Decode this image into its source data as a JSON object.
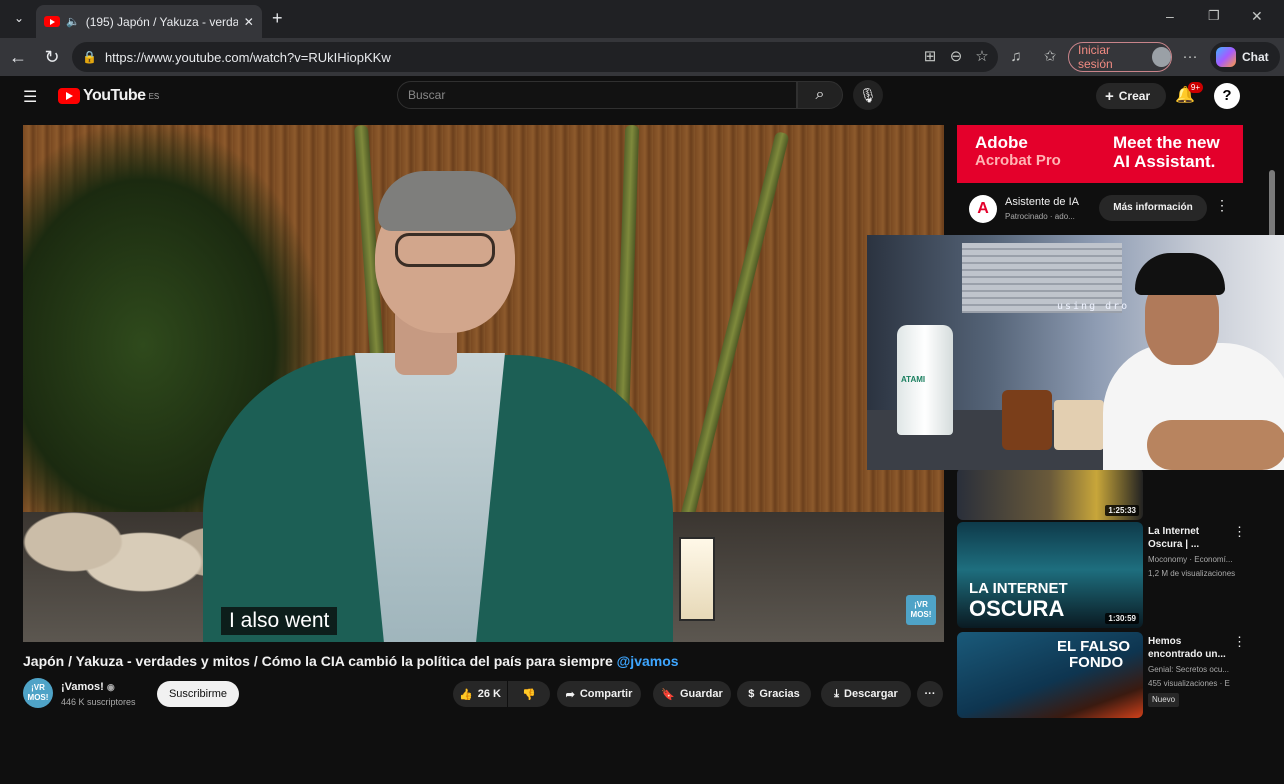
{
  "browser": {
    "tab_title": "(195) Japón / Yakuza - verdad",
    "url": "https://www.youtube.com/watch?v=RUkIHiopKKw",
    "signin_label": "Iniciar sesión",
    "chat_label": "Chat"
  },
  "youtube": {
    "logo_text": "YouTube",
    "logo_region": "ES",
    "search_placeholder": "Buscar",
    "create_label": "Crear",
    "notif_badge": "9+"
  },
  "video": {
    "caption": "I also went",
    "watermark": "¡VR MOS!",
    "title": "Japón / Yakuza - verdades y mitos / Cómo la CIA cambió la política del país para siempre",
    "title_tag": "@jvamos",
    "channel_avatar_text": "¡VR MOS!",
    "channel_name": "¡Vamos!",
    "subscribers": "446 K suscriptores",
    "subscribe_label": "Suscribirme",
    "likes": "26 K",
    "share_label": "Compartir",
    "save_label": "Guardar",
    "thanks_label": "Gracias",
    "download_label": "Descargar"
  },
  "ad": {
    "banner_left_1": "Adobe",
    "banner_left_2": "Acrobat Pro",
    "banner_right_1": "Meet the new",
    "banner_right_2": "AI Assistant.",
    "title": "Asistente de IA",
    "sponsor": "Patrocinado · ado...",
    "more_label": "Más información"
  },
  "webcam": {
    "overlay_text": "using dro",
    "bottle_label": "ATAMI"
  },
  "recommendations": [
    {
      "duration": "1:25:33"
    },
    {
      "thumb_text_1": "LA INTERNET",
      "thumb_text_2": "OSCURA",
      "duration": "1:30:59",
      "title_line1": "La Internet",
      "title_line2": "Oscura | ...",
      "channel": "Moconomy · Economí...",
      "views": "1,2 M de visualizaciones"
    },
    {
      "thumb_text_1": "EL FALSO",
      "thumb_text_2": "FONDO",
      "title_line1": "Hemos",
      "title_line2": "encontrado un...",
      "channel": "Genial: Secretos ocu...",
      "views": "455 visualizaciones · E",
      "badge": "Nuevo"
    }
  ]
}
